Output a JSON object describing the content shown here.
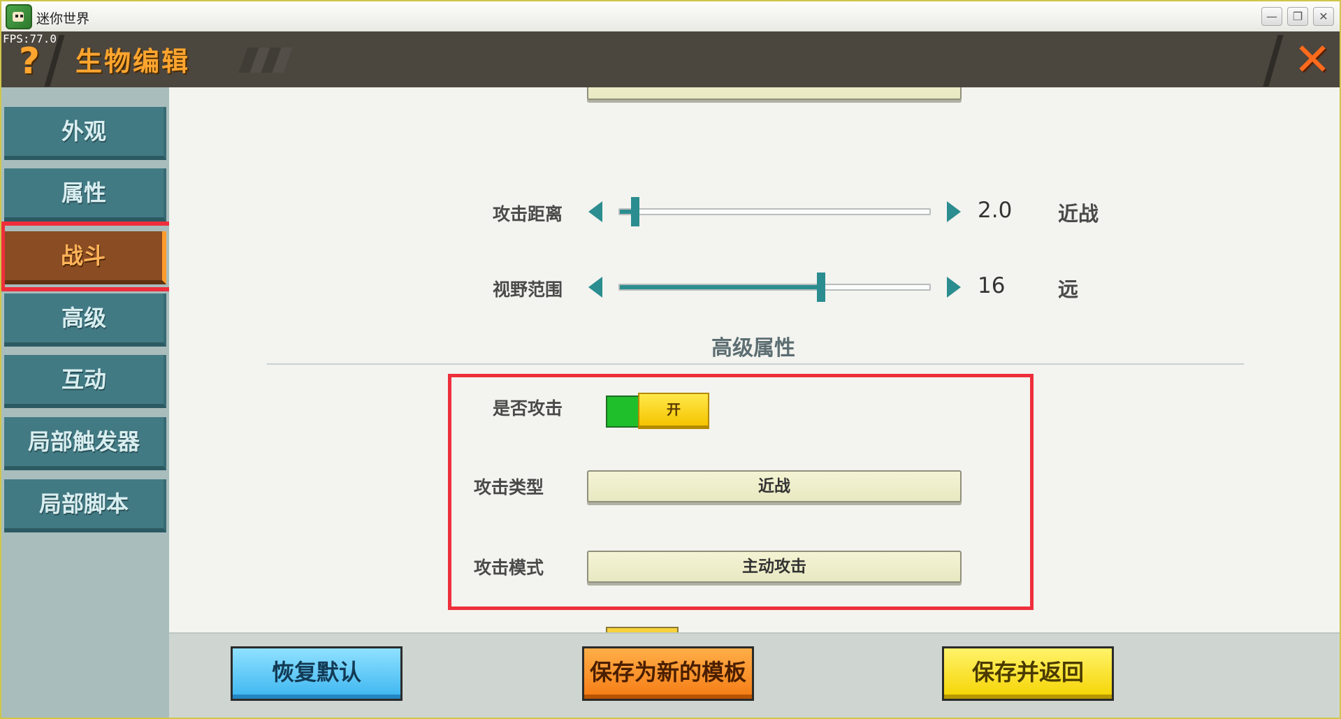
{
  "window": {
    "title": "迷你世界",
    "minimize_glyph": "—",
    "restore_glyph": "❐",
    "close_glyph": "✕"
  },
  "fps": "FPS:77.0",
  "header": {
    "help_glyph": "?",
    "title": "生物编辑",
    "close_glyph": "✕"
  },
  "sidebar": {
    "items": [
      {
        "label": "外观"
      },
      {
        "label": "属性"
      },
      {
        "label": "战斗",
        "active": true
      },
      {
        "label": "高级"
      },
      {
        "label": "互动"
      },
      {
        "label": "局部触发器"
      },
      {
        "label": "局部脚本"
      }
    ]
  },
  "content": {
    "attack_range": {
      "label": "攻击距离",
      "value": "2.0",
      "desc": "近战",
      "fraction": 0.05
    },
    "view_range": {
      "label": "视野范围",
      "value": "16",
      "desc": "远",
      "fraction": 0.65
    },
    "advanced_section_title": "高级属性",
    "can_attack": {
      "label": "是否攻击",
      "state": "开",
      "on": true
    },
    "attack_type": {
      "label": "攻击类型",
      "value": "近战"
    },
    "attack_mode": {
      "label": "攻击模式",
      "value": "主动攻击"
    }
  },
  "buttons": {
    "restore_default": "恢复默认",
    "save_as_template": "保存为新的模板",
    "save_and_return": "保存并返回"
  },
  "colors": {
    "accent_teal": "#2b8d8f",
    "active_tab": "#8a4c23",
    "highlight_red": "#ee2f3b"
  }
}
